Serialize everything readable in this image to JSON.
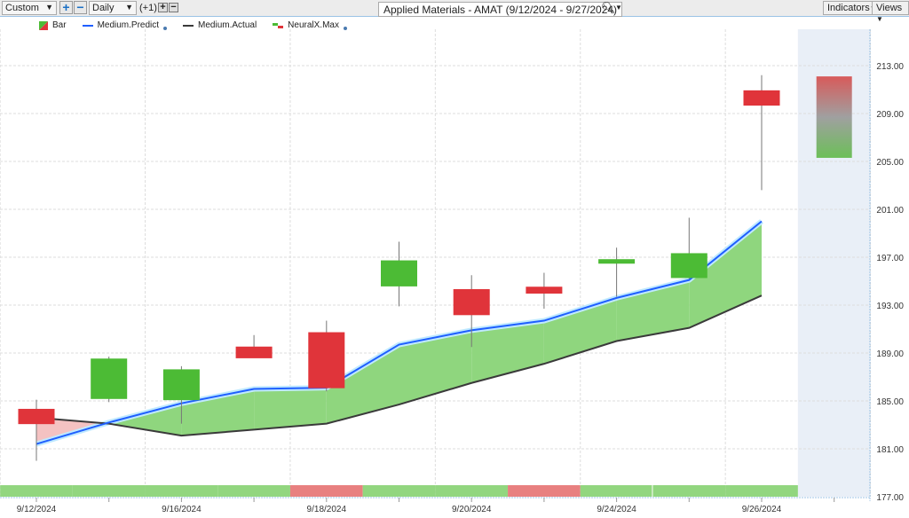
{
  "toolbar": {
    "range_select": "Custom",
    "interval_select": "Daily",
    "offset": "(+1)",
    "title": "Applied Materials - AMAT (9/12/2024 - 9/27/2024)",
    "indicators": "Indicators",
    "views": "Views"
  },
  "legend": [
    "Bar",
    "Medium.Predict",
    "Medium.Actual",
    "NeuralX.Max"
  ],
  "colors": {
    "up": "#4cbb35",
    "down": "#e0343a",
    "predict": "#1f5fff",
    "actual": "#3a3a3a",
    "fill_pos": "#8fd67e",
    "fill_neg": "#f4c2c2",
    "strip_green": "#92d67f",
    "strip_red": "#e88080",
    "forecast_bg": "#e9eff7"
  },
  "chart_data": {
    "type": "candlestick",
    "title": "Applied Materials - AMAT (9/12/2024 - 9/27/2024)",
    "ylim": [
      177,
      215
    ],
    "y_ticks": [
      "177.00",
      "181.00",
      "185.00",
      "189.00",
      "193.00",
      "197.00",
      "201.00",
      "205.00",
      "209.00",
      "213.00"
    ],
    "y_tick_values": [
      177,
      181,
      185,
      189,
      193,
      197,
      201,
      205,
      209,
      213
    ],
    "x_tick_labels": [
      "9/12/2024",
      "9/16/2024",
      "9/18/2024",
      "9/20/2024",
      "9/24/2024",
      "9/26/2024"
    ],
    "x_tick_indices": [
      0,
      2,
      4,
      6,
      8,
      10
    ],
    "candles": [
      {
        "o": 184.3,
        "h": 185.1,
        "l": 180.0,
        "c": 183.1
      },
      {
        "o": 185.2,
        "h": 188.7,
        "l": 184.9,
        "c": 188.5
      },
      {
        "o": 185.1,
        "h": 187.9,
        "l": 183.1,
        "c": 187.6
      },
      {
        "o": 189.5,
        "h": 190.5,
        "l": 188.6,
        "c": 188.6
      },
      {
        "o": 190.7,
        "h": 191.7,
        "l": 185.8,
        "c": 186.1
      },
      {
        "o": 194.6,
        "h": 198.3,
        "l": 192.9,
        "c": 196.7
      },
      {
        "o": 194.3,
        "h": 195.5,
        "l": 189.5,
        "c": 192.2
      },
      {
        "o": 194.5,
        "h": 195.7,
        "l": 192.7,
        "c": 194.0
      },
      {
        "o": 196.5,
        "h": 197.8,
        "l": 193.7,
        "c": 196.8
      },
      {
        "o": 195.3,
        "h": 200.3,
        "l": 195.2,
        "c": 197.3
      },
      {
        "o": 210.9,
        "h": 212.2,
        "l": 202.6,
        "c": 209.7
      }
    ],
    "forecast": {
      "high": 212.1,
      "low": 205.3
    },
    "series": [
      {
        "name": "Medium.Predict",
        "values": [
          181.4,
          183.2,
          184.8,
          186.0,
          186.1,
          189.7,
          190.9,
          191.7,
          193.6,
          195.1,
          200.0
        ]
      },
      {
        "name": "Medium.Actual",
        "values": [
          183.6,
          183.1,
          182.1,
          182.6,
          183.1,
          184.7,
          186.5,
          188.1,
          190.0,
          191.1,
          193.8
        ]
      }
    ],
    "neuralx_strip": [
      "up",
      "up",
      "up",
      "up",
      "down",
      "up",
      "up",
      "down",
      "up",
      "up",
      "up"
    ],
    "grid": true
  }
}
